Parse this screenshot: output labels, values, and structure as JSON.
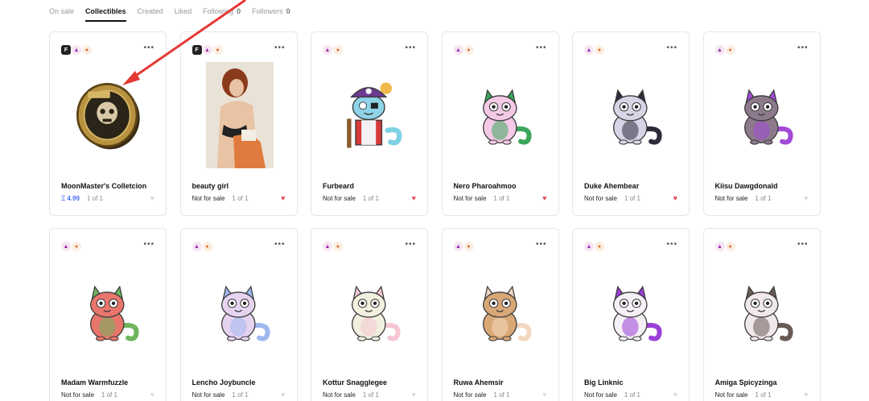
{
  "tabs": [
    {
      "label": "On sale",
      "active": false,
      "count": ""
    },
    {
      "label": "Collectibles",
      "active": true,
      "count": ""
    },
    {
      "label": "Created",
      "active": false,
      "count": ""
    },
    {
      "label": "Liked",
      "active": false,
      "count": ""
    },
    {
      "label": "Following",
      "active": false,
      "count": "0"
    },
    {
      "label": "Followers",
      "active": false,
      "count": "0"
    }
  ],
  "cards": [
    {
      "title": "MoonMaster's Colletcion",
      "price": "Ξ 4.99",
      "edition": "1 of 1",
      "liked": false,
      "art": "coin",
      "owner": "F",
      "colors": {
        "body": "",
        "accent": ""
      }
    },
    {
      "title": "beauty girl",
      "price": "Not for sale",
      "edition": "1 of 1",
      "liked": true,
      "art": "photo",
      "owner": "F",
      "colors": {
        "body": "",
        "accent": ""
      }
    },
    {
      "title": "Furbeard",
      "price": "Not for sale",
      "edition": "1 of 1",
      "liked": true,
      "art": "pirate",
      "owner": "",
      "colors": {
        "body": "#8fd3e8",
        "accent": "#d63a3a"
      }
    },
    {
      "title": "Nero Pharoahmoo",
      "price": "Not for sale",
      "edition": "1 of 1",
      "liked": true,
      "art": "cat",
      "owner": "",
      "colors": {
        "body": "#f3c9e6",
        "accent": "#3aa55b"
      }
    },
    {
      "title": "Duke Ahembear",
      "price": "Not for sale",
      "edition": "1 of 1",
      "liked": true,
      "art": "cat",
      "owner": "",
      "colors": {
        "body": "#d8d4e6",
        "accent": "#2b2b3a"
      }
    },
    {
      "title": "Kiisu Dawgdonald",
      "price": "Not for sale",
      "edition": "1 of 1",
      "liked": false,
      "art": "cat",
      "owner": "",
      "colors": {
        "body": "#8c7a8c",
        "accent": "#a24ad6"
      }
    },
    {
      "title": "Madam Warmfuzzle",
      "price": "Not for sale",
      "edition": "1 of 1",
      "liked": false,
      "art": "cat",
      "owner": "",
      "colors": {
        "body": "#e8766c",
        "accent": "#6fb55f"
      }
    },
    {
      "title": "Lencho Joybuncle",
      "price": "Not for sale",
      "edition": "1 of 1",
      "liked": false,
      "art": "cat",
      "owner": "",
      "colors": {
        "body": "#e6d3f0",
        "accent": "#9fb8f0"
      }
    },
    {
      "title": "Kottur Snagglegee",
      "price": "Not for sale",
      "edition": "1 of 1",
      "liked": false,
      "art": "cat",
      "owner": "",
      "colors": {
        "body": "#f2f0df",
        "accent": "#f5c7d3"
      }
    },
    {
      "title": "Ruwa Ahemsir",
      "price": "Not for sale",
      "edition": "1 of 1",
      "liked": false,
      "art": "cat",
      "owner": "",
      "colors": {
        "body": "#d9a877",
        "accent": "#f2d8c0"
      }
    },
    {
      "title": "Big Linknic",
      "price": "Not for sale",
      "edition": "1 of 1",
      "liked": false,
      "art": "cat",
      "owner": "",
      "colors": {
        "body": "#f4f0f6",
        "accent": "#9b3fd6"
      }
    },
    {
      "title": "Amiga Spicyzinga",
      "price": "Not for sale",
      "edition": "1 of 1",
      "liked": false,
      "art": "cat",
      "owner": "",
      "colors": {
        "body": "#f0e8ea",
        "accent": "#6a5a55"
      }
    }
  ],
  "annotation": {
    "color": "#e53935"
  }
}
